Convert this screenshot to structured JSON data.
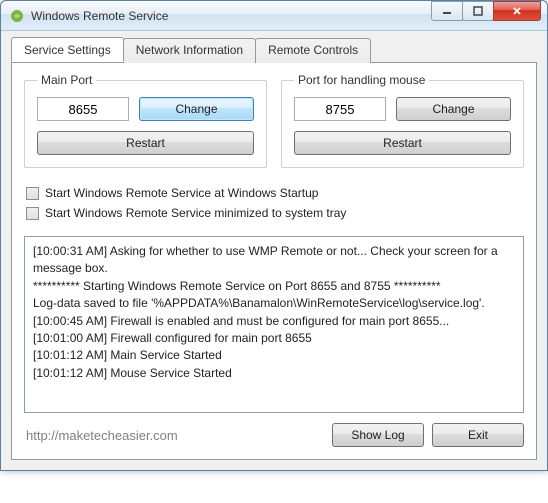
{
  "window": {
    "title": "Windows Remote Service"
  },
  "tabs": [
    {
      "label": "Service Settings"
    },
    {
      "label": "Network Information"
    },
    {
      "label": "Remote Controls"
    }
  ],
  "main_port": {
    "legend": "Main Port",
    "value": "8655",
    "change_label": "Change",
    "restart_label": "Restart"
  },
  "mouse_port": {
    "legend": "Port for handling mouse",
    "value": "8755",
    "change_label": "Change",
    "restart_label": "Restart"
  },
  "checkboxes": {
    "startup": "Start Windows Remote Service at Windows Startup",
    "minimize": "Start Windows Remote Service minimized to system tray"
  },
  "log": {
    "lines": [
      "[10:00:31 AM] Asking for whether to use WMP Remote or not... Check your screen for a message box.",
      "********** Starting Windows Remote Service on Port 8655 and 8755 **********",
      "Log-data saved to file '%APPDATA%\\Banamalon\\WinRemoteService\\log\\service.log'.",
      "[10:00:45 AM] Firewall is enabled and must be configured for main port 8655...",
      "[10:01:00 AM] Firewall configured for main port 8655",
      "[10:01:12 AM] Main Service Started",
      "[10:01:12 AM] Mouse Service Started"
    ]
  },
  "footer": {
    "watermark": "http://maketecheasier.com",
    "show_log": "Show Log",
    "exit": "Exit"
  }
}
